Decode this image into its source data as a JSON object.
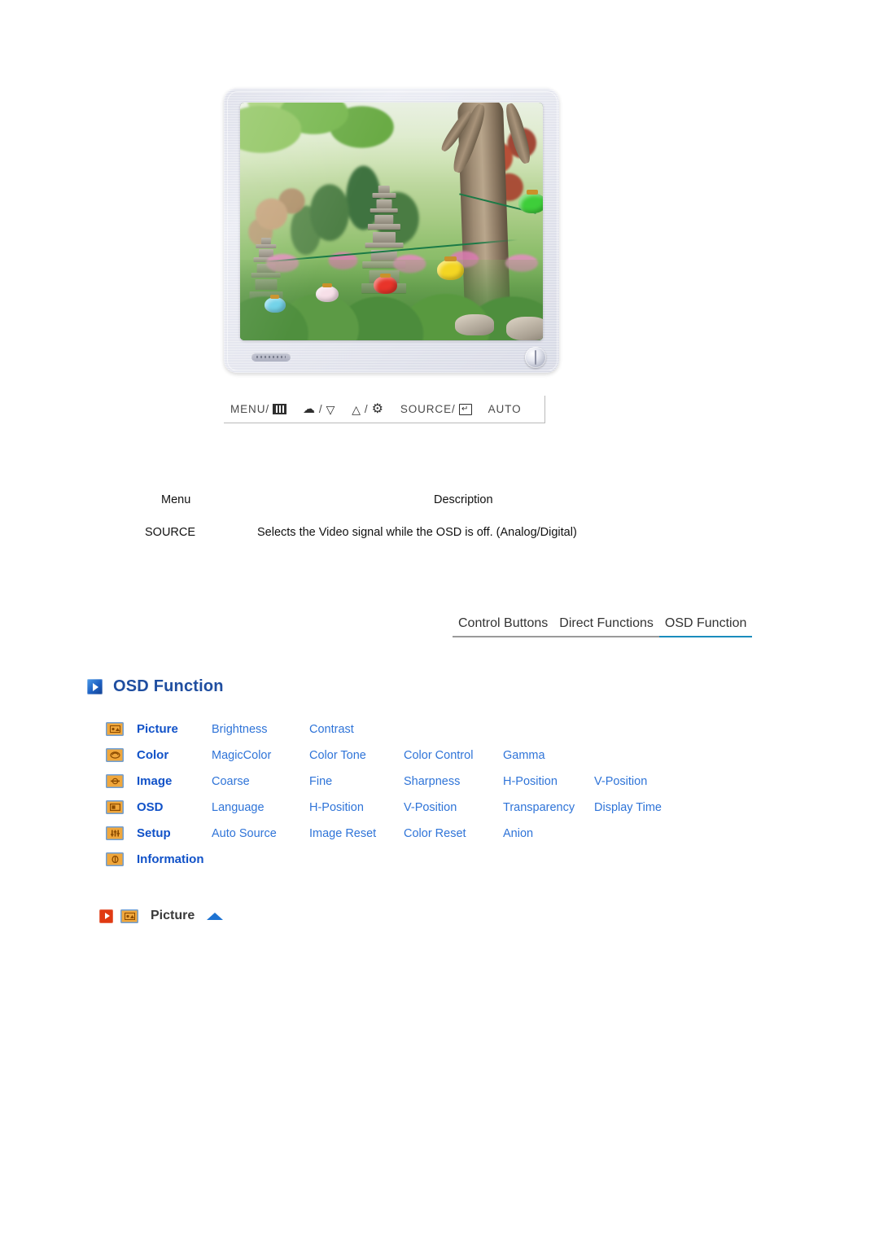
{
  "figure": {
    "alt": "Samsung LCD monitor front view displaying a garden photo with stone pagodas and paper lanterns",
    "bezel_color": "#dcdee9",
    "screen_caption": "garden-photo"
  },
  "button_legend": [
    {
      "label": "MENU/",
      "icon": "menu-icon",
      "glyph": "menu"
    },
    {
      "label": "/",
      "icon": "brightness-down-icon",
      "glyph_left": "brightness",
      "glyph_right": "down-arrow"
    },
    {
      "label": "/",
      "icon": "up-arrow-magiccolor-icon",
      "glyph_left": "up-arrow",
      "glyph_right": "gear"
    },
    {
      "label": "SOURCE/",
      "icon": "enter-icon",
      "glyph": "enter"
    },
    {
      "label": "AUTO",
      "icon": "auto-label",
      "glyph": ""
    }
  ],
  "description_table": {
    "headers": {
      "menu": "Menu",
      "description": "Description"
    },
    "rows": [
      {
        "menu": "SOURCE",
        "description": "Selects the Video signal while the OSD is off. (Analog/Digital)"
      }
    ]
  },
  "tabs": [
    {
      "label": "Control Buttons",
      "active": false
    },
    {
      "label": "Direct Functions",
      "active": false
    },
    {
      "label": "OSD Function",
      "active": true
    }
  ],
  "tab_accent_color": "#1a8cbd",
  "osd_section": {
    "heading": "OSD Function",
    "heading_color": "#1f4ea0",
    "rows": [
      {
        "icon": "picture-icon",
        "label": "Picture",
        "items": [
          "Brightness",
          "Contrast"
        ]
      },
      {
        "icon": "color-icon",
        "label": "Color",
        "items": [
          "MagicColor",
          "Color Tone",
          "Color Control",
          "Gamma"
        ]
      },
      {
        "icon": "image-icon",
        "label": "Image",
        "items": [
          "Coarse",
          "Fine",
          "Sharpness",
          "H-Position",
          "V-Position"
        ]
      },
      {
        "icon": "osd-icon",
        "label": "OSD",
        "items": [
          "Language",
          "H-Position",
          "V-Position",
          "Transparency",
          "Display Time"
        ]
      },
      {
        "icon": "setup-icon",
        "label": "Setup",
        "items": [
          "Auto Source",
          "Image Reset",
          "Color Reset",
          "Anion"
        ]
      },
      {
        "icon": "information-icon",
        "label": "Information",
        "items": []
      }
    ],
    "label_color": "#1152c8",
    "item_color": "#2f74d8",
    "icon_color": "#f0a73c"
  },
  "picture_section": {
    "title": "Picture",
    "bullet_icon": "red-play-icon",
    "menu_icon": "picture-icon",
    "top_arrow_icon": "up-triangle-icon",
    "bullet_color": "#e03a12",
    "arrow_color": "#1e73d2"
  }
}
